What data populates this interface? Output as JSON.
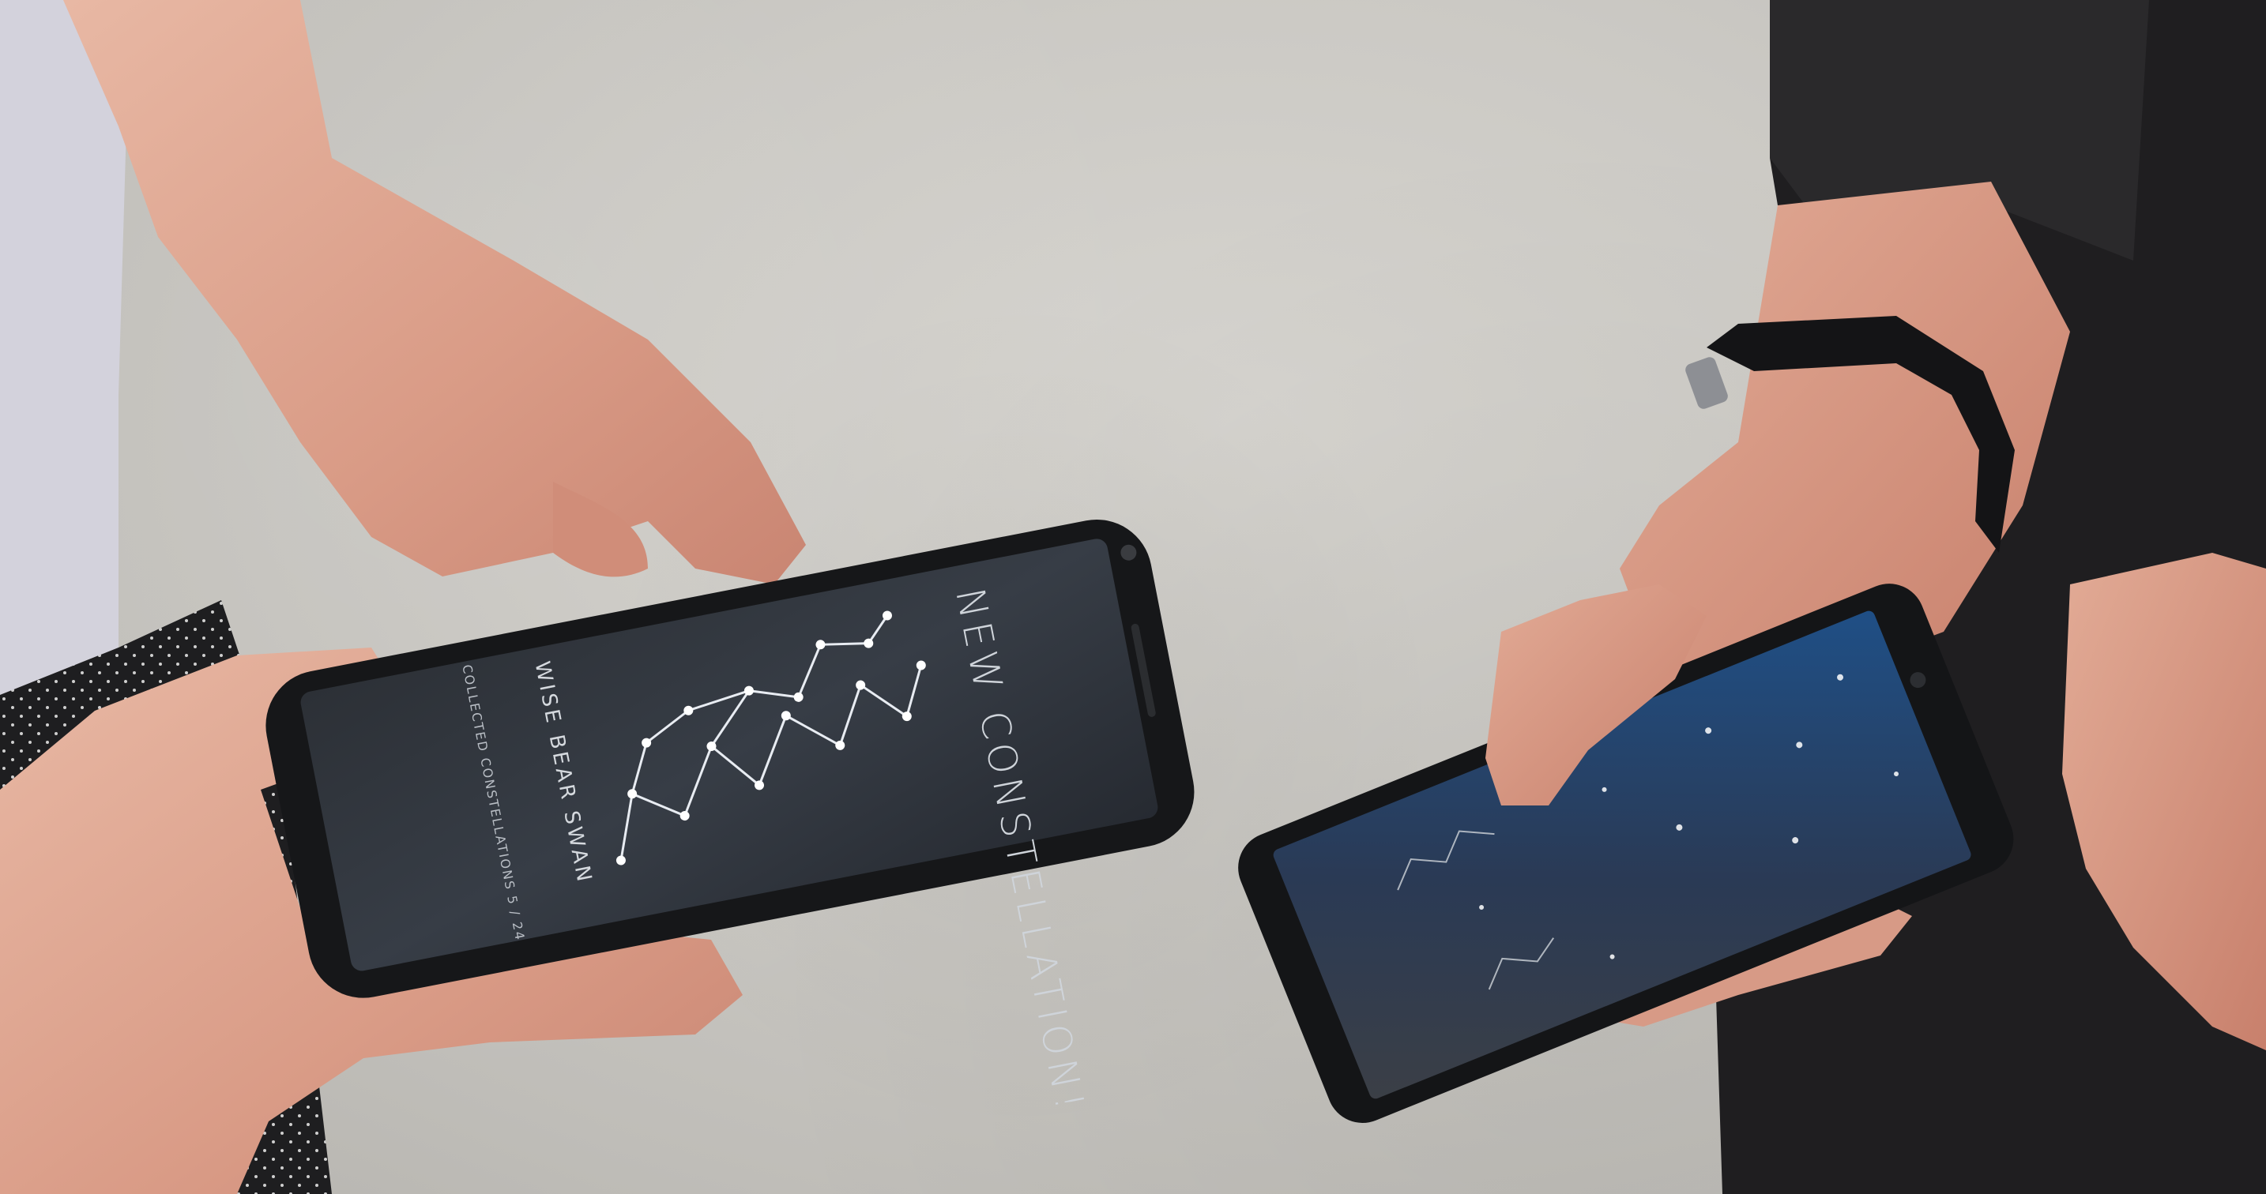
{
  "left_phone": {
    "title": "NEW CONSTELLATION!",
    "constellation_name": "WISE BEAR SWAN",
    "count_label": "COLLECTED CONSTELLATIONS 5 / 24"
  },
  "right_phone": {
    "screen": "starfield"
  }
}
